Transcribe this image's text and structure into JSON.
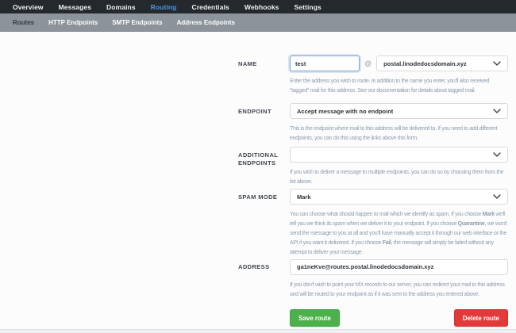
{
  "nav": {
    "items": [
      {
        "label": "Overview",
        "active": false
      },
      {
        "label": "Messages",
        "active": false
      },
      {
        "label": "Domains",
        "active": false
      },
      {
        "label": "Routing",
        "active": true
      },
      {
        "label": "Credentials",
        "active": false
      },
      {
        "label": "Webhooks",
        "active": false
      },
      {
        "label": "Settings",
        "active": false
      }
    ]
  },
  "subnav": {
    "items": [
      {
        "label": "Routes",
        "active": true
      },
      {
        "label": "HTTP Endpoints",
        "active": false
      },
      {
        "label": "SMTP Endpoints",
        "active": false
      },
      {
        "label": "Address Endpoints",
        "active": false
      }
    ]
  },
  "form": {
    "name": {
      "label": "Name",
      "value": "test",
      "separator": "@",
      "domain": "postal.linodedocsdomain.xyz",
      "help": "Enter the address you wish to route. In addition to the name you enter, you'll also received \"tagged\" mail for this address. See our documentation for details about tagged mail."
    },
    "endpoint": {
      "label": "Endpoint",
      "value": "Accept message with no endpoint",
      "help": "This is the endpoint where mail to this address will be delivered to. If you need to add different endpoints, you can do this using the links above this form."
    },
    "additional_endpoints": {
      "label": "Additional Endpoints",
      "value": "",
      "help": "If you wish to deliver a message to multiple endpoints, you can do so by choosing them from the list above."
    },
    "spam_mode": {
      "label": "Spam Mode",
      "value": "Mark",
      "help_segments": [
        {
          "text": "You can choose what should happen to mail which we identify as spam. If you choose ",
          "bold": false
        },
        {
          "text": "Mark",
          "bold": true
        },
        {
          "text": " we'll tell you we think its spam when we deliver it to your endpoint. If you choose ",
          "bold": false
        },
        {
          "text": "Quarantine",
          "bold": true
        },
        {
          "text": ", we won't send the message to you at all and you'll have manually accept it through our web interface or the API if you want it delivered. If you choose ",
          "bold": false
        },
        {
          "text": "Fail",
          "bold": true
        },
        {
          "text": ", the message will simply be failed without any attempt to deliver your message.",
          "bold": false
        }
      ]
    },
    "address": {
      "label": "Address",
      "value": "ga1neKve@routes.postal.linodedocsdomain.xyz",
      "help": "If you don't wish to point your MX records to our server, you can redirect your mail to this address and will be routed to your endpoint as if it was sent to the address you entered above."
    },
    "buttons": {
      "save": "Save route",
      "delete": "Delete route"
    }
  },
  "icons": {
    "chevron_down": "v-shaped chevron",
    "at_sign": "@"
  },
  "colors": {
    "topnav_bg": "#24292e",
    "nav_active": "#4a97e4",
    "subnav_bg": "#8c939b",
    "subnav_active_text": "#343941",
    "content_bg": "#fcfcfd",
    "field_border": "#d7dadd",
    "field_text": "#2e3338",
    "focus_border": "#7ba6da",
    "help_text": "#8d9daf",
    "save_green": "#4cb14c",
    "delete_red": "#e23a3a"
  }
}
